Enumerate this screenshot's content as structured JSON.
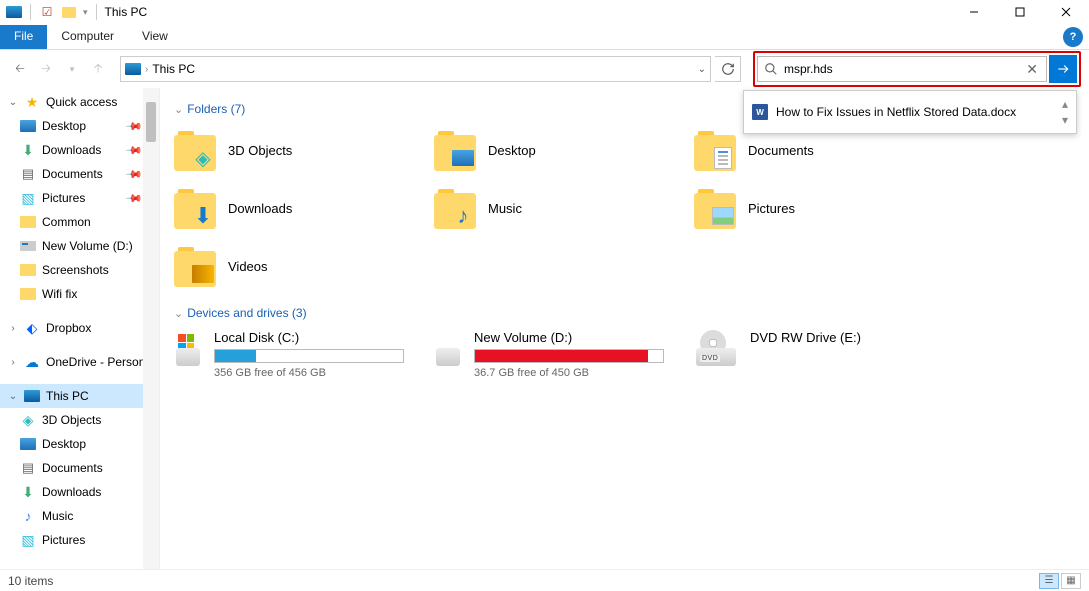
{
  "window": {
    "title": "This PC"
  },
  "ribbon": {
    "file": "File",
    "computer": "Computer",
    "view": "View"
  },
  "address": {
    "location": "This PC"
  },
  "search": {
    "value": "mspr.hds",
    "suggestion": "How to Fix Issues in Netflix Stored Data.docx"
  },
  "sidebar": {
    "quick_access": "Quick access",
    "qa_items": [
      {
        "label": "Desktop",
        "pinned": true
      },
      {
        "label": "Downloads",
        "pinned": true
      },
      {
        "label": "Documents",
        "pinned": true
      },
      {
        "label": "Pictures",
        "pinned": true
      },
      {
        "label": "Common",
        "pinned": false
      },
      {
        "label": "New Volume (D:)",
        "pinned": false
      },
      {
        "label": "Screenshots",
        "pinned": false
      },
      {
        "label": "Wifi fix",
        "pinned": false
      }
    ],
    "dropbox": "Dropbox",
    "onedrive": "OneDrive - Personal",
    "this_pc": "This PC",
    "pc_items": [
      {
        "label": "3D Objects"
      },
      {
        "label": "Desktop"
      },
      {
        "label": "Documents"
      },
      {
        "label": "Downloads"
      },
      {
        "label": "Music"
      },
      {
        "label": "Pictures"
      }
    ]
  },
  "content": {
    "folders_header": "Folders (7)",
    "folders": [
      {
        "label": "3D Objects"
      },
      {
        "label": "Desktop"
      },
      {
        "label": "Documents"
      },
      {
        "label": "Downloads"
      },
      {
        "label": "Music"
      },
      {
        "label": "Pictures"
      },
      {
        "label": "Videos"
      }
    ],
    "drives_header": "Devices and drives (3)",
    "drives": [
      {
        "name": "Local Disk (C:)",
        "free": "356 GB free of 456 GB",
        "fill_pct": 22,
        "color": "blue",
        "os": true
      },
      {
        "name": "New Volume (D:)",
        "free": "36.7 GB free of 450 GB",
        "fill_pct": 92,
        "color": "red",
        "os": false
      },
      {
        "name": "DVD RW Drive (E:)",
        "free": "",
        "fill_pct": 0,
        "color": "",
        "dvd": true
      }
    ]
  },
  "statusbar": {
    "count": "10 items"
  }
}
